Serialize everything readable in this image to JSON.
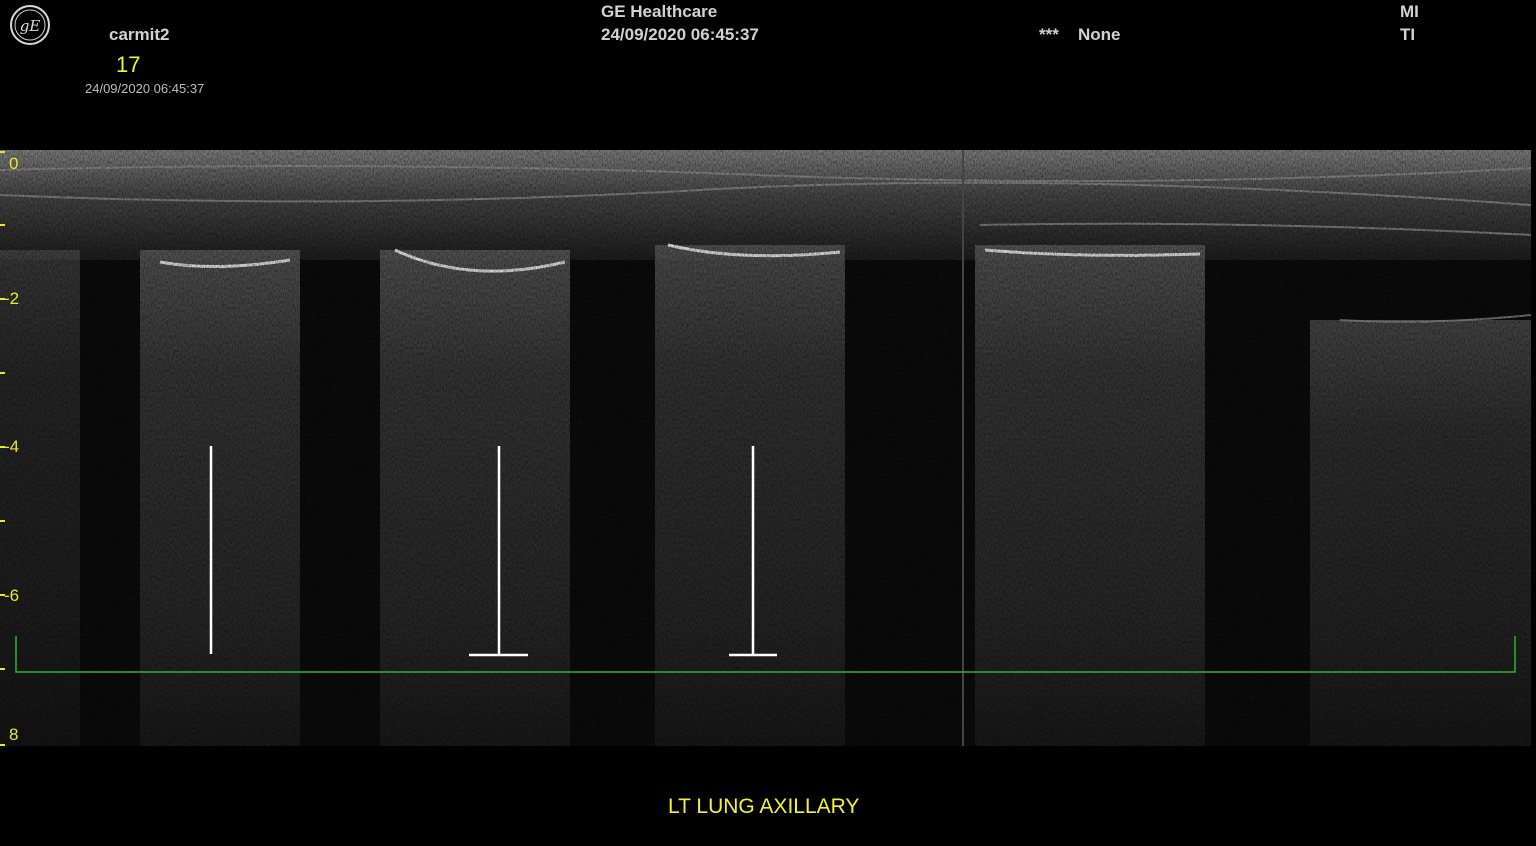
{
  "header": {
    "operator": "carmit2",
    "frame_number": "17",
    "timestamp_small": "24/09/2020 06:45:37",
    "manufacturer": "GE Healthcare",
    "timestamp": "24/09/2020 06:45:37",
    "preset_marker": "***",
    "preset_value": "None",
    "mi_label": "MI",
    "ti_label": "TI"
  },
  "depth_scale": {
    "labels": [
      "0",
      "-2",
      "-4",
      "-6",
      "8"
    ],
    "color": "#e8e82c"
  },
  "measurement_color": "#2db52d",
  "caliper_color": "#ffffff",
  "annotation": {
    "caption": "LT LUNG AXILLARY"
  },
  "icons": {
    "logo": "ge-logo-icon"
  }
}
